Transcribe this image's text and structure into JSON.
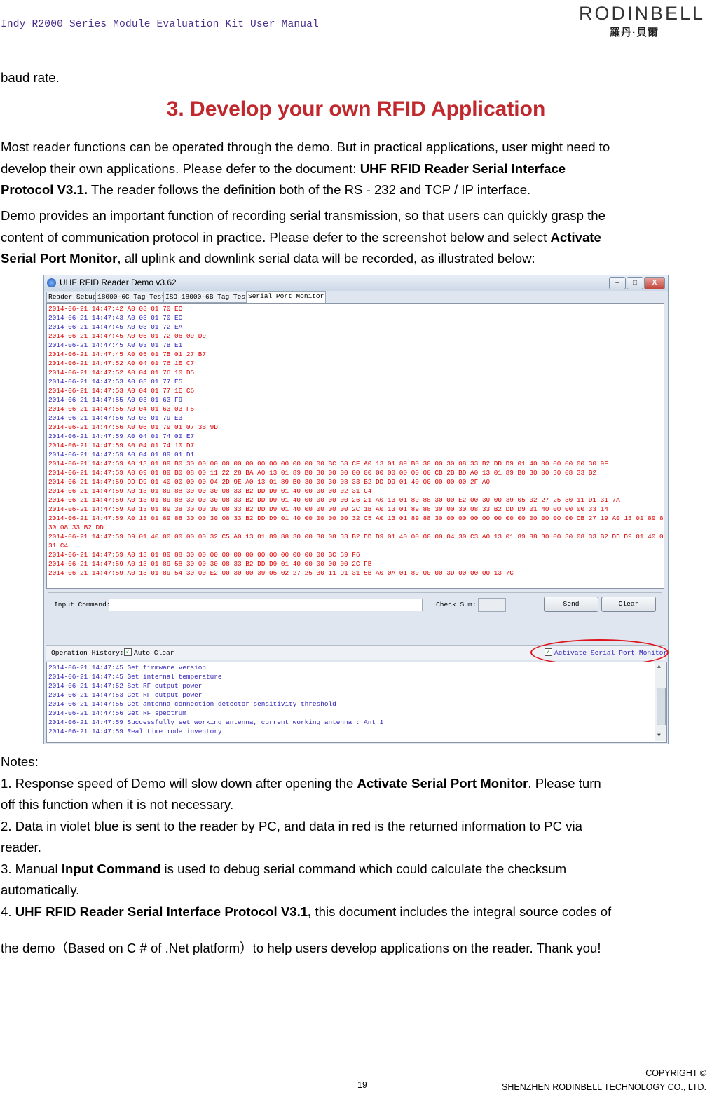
{
  "header": {
    "title": "Indy R2000 Series Module Evaluation Kit User Manual",
    "logo_text": "RODINBELL",
    "logo_sub": "羅丹·貝爾"
  },
  "intro_line": "baud rate.",
  "heading": "3. Develop your own RFID Application",
  "para1": {
    "l1": "Most reader functions can be operated through the demo. But in practical applications, user might need to",
    "l2a": "develop their own applications. Please defer to the document: ",
    "l2b": "UHF RFID Reader Serial Interface",
    "l3a": "Protocol V3.1.",
    "l3b": " The reader follows the definition both of the RS - 232 and TCP / IP interface."
  },
  "para2": {
    "l1": "Demo provides an important function of recording serial transmission, so that users can quickly grasp the",
    "l2a": "content of communication protocol in practice. Please defer to the screenshot below and select ",
    "l2b": "Activate",
    "l3a": "Serial Port Monitor",
    "l3b": ", all uplink and downlink serial data will be recorded, as illustrated below:"
  },
  "screenshot": {
    "title": "UHF RFID Reader Demo v3.62",
    "win_buttons": [
      "–",
      "□",
      "X"
    ],
    "tabs": [
      "Reader Setup",
      "18000-6C Tag Test",
      "ISO 18000-6B Tag Test",
      "Serial Port Monitor"
    ],
    "active_tab": 3,
    "log": [
      {
        "c": "red",
        "t": "2014-06-21 14:47:42  A0 03 01 70 EC"
      },
      {
        "c": "blue",
        "t": "2014-06-21 14:47:43  A0 03 01 70 EC"
      },
      {
        "c": "blue",
        "t": "2014-06-21 14:47:45  A0 03 01 72 EA"
      },
      {
        "c": "red",
        "t": "2014-06-21 14:47:45  A0 05 01 72 06 09 D9"
      },
      {
        "c": "blue",
        "t": "2014-06-21 14:47:45  A0 03 01 7B E1"
      },
      {
        "c": "red",
        "t": "2014-06-21 14:47:45  A0 05 01 7B 01 27 B7"
      },
      {
        "c": "red",
        "t": "2014-06-21 14:47:52  A0 04 01 76 1E C7"
      },
      {
        "c": "red",
        "t": "2014-06-21 14:47:52  A0 04 01 76 10 D5"
      },
      {
        "c": "blue",
        "t": "2014-06-21 14:47:53  A0 03 01 77 E5"
      },
      {
        "c": "red",
        "t": "2014-06-21 14:47:53  A0 04 01 77 1E C6"
      },
      {
        "c": "blue",
        "t": "2014-06-21 14:47:55  A0 03 01 63 F9"
      },
      {
        "c": "red",
        "t": "2014-06-21 14:47:55  A0 04 01 63 03 F5"
      },
      {
        "c": "blue",
        "t": "2014-06-21 14:47:56  A0 03 01 79 E3"
      },
      {
        "c": "red",
        "t": "2014-06-21 14:47:56  A0 06 01 79 01 07 3B 9D"
      },
      {
        "c": "blue",
        "t": "2014-06-21 14:47:59  A0 04 01 74 00 E7"
      },
      {
        "c": "red",
        "t": "2014-06-21 14:47:59  A0 04 01 74 10 D7"
      },
      {
        "c": "blue",
        "t": "2014-06-21 14:47:59  A0 04 01 89 01 D1"
      },
      {
        "c": "red",
        "t": "2014-06-21 14:47:59  A0 13 01 89 B0 30 00 00 00 00 00 00 00 00 00 00 00 BC 58 CF A0 13 01 89 B0 30 00 30 08 33 B2 DD D9 01 40 00 00 00 00 30 9F"
      },
      {
        "c": "red",
        "t": "2014-06-21 14:47:59  A0 09 01 89 B0 08 00 11 22 28 BA A0 13 01 89 B0 30 00 00 00 00 00 00 00 00 00 CB 2B BD A0 13 01 89 B0 30 00 30 08 33 B2"
      },
      {
        "c": "red",
        "t": "2014-06-21 14:47:59  DD D9 01 40 00 00 00 04 2D 9E A0 13 01 89 B0 30 00 30 08 33 B2 DD D9 01 40 00 00 00 00 2F A0"
      },
      {
        "c": "red",
        "t": "2014-06-21 14:47:59  A0 13 01 89 88 30 00 30 08 33 B2 DD D9 01 40 00 00 00 02 31 C4"
      },
      {
        "c": "red",
        "t": "2014-06-21 14:47:59  A0 13 01 89 88 30 00 30 08 33 B2 DD D9 01 40 00 00 00 00 26 21 A0 13 01 89 88 30 00 E2 00 30 00 39 05 02 27 25 30 11 D1 31 7A"
      },
      {
        "c": "red",
        "t": "2014-06-21 14:47:59  A0 13 01 89 38 30 00 30 08 33 B2 DD D9 01 40 00 00 00 00 2C 1B A0 13 01 89 88 30 00 30 08 33 B2 DD D9 01 40 00 00 00 33 14"
      },
      {
        "c": "red",
        "t": "2014-06-21 14:47:59  A0 13 01 89 88 30 00 30 08 33 B2 DD D9 01 40 00 00 00 00 32 C5 A0 13 01 89 88 30 00 00 00 00 00 00 00 00 00 00 00 CB 27 19 A0 13 01 89 88 30 00"
      },
      {
        "c": "red",
        "t": "30 08 33 B2 DD"
      },
      {
        "c": "red",
        "t": "2014-06-21 14:47:59  D9 01 40 00 00 00 00 32 C5 A0 13 01 89 88 30 00 30 08 33 B2 DD D9 01 40 00 00 00 04 30 C3 A0 13 01 89 88 30 00 30 08 33 B2 DD D9 01 40 00 00 00 02"
      },
      {
        "c": "red",
        "t": "31 C4"
      },
      {
        "c": "red",
        "t": "2014-06-21 14:47:59  A0 13 01 89 88 30 00 00 00 00 00 00 00 00 00 00 00 BC 59 F6"
      },
      {
        "c": "red",
        "t": "2014-06-21 14:47:59  A0 13 01 89 58 30 00 30 08 33 B2 DD D9 01 40 00 00 00 00 2C FB"
      },
      {
        "c": "red",
        "t": "2014-06-21 14:47:59  A0 13 01 89 54 30 00 E2 00 30 00 39 05 02 27 25 30 11 D1 31 5B A0 0A 01 89 00 00 3D 00 00 00 13 7C"
      }
    ],
    "input_command_label": "Input Command:",
    "input_command_value": "",
    "checksum_label": "Check Sum:",
    "checksum_value": "",
    "send_label": "Send",
    "clear_label": "Clear",
    "op_history_label": "Operation History:",
    "auto_clear_label": "Auto Clear",
    "auto_clear_checked": true,
    "activate_label": "Activate Serial Port Monitor",
    "activate_checked": true,
    "history": [
      "2014-06-21 14:47:45 Get firmware version",
      "2014-06-21 14:47:45 Get internal temperature",
      "2014-06-21 14:47:52 Set RF output power",
      "2014-06-21 14:47:53 Get RF output power",
      "2014-06-21 14:47:55 Get antenna connection detector sensitivity threshold",
      "2014-06-21 14:47:56 Get RF spectrum",
      "2014-06-21 14:47:59 Successfully set working antenna, current working antenna : Ant 1",
      "2014-06-21 14:47:59 Real time mode inventory"
    ]
  },
  "notes": {
    "title": "Notes:",
    "n1a": "1. Response speed of Demo will slow down after opening the ",
    "n1b": "Activate Serial Port Monitor",
    "n1c": ". Please turn",
    "n1d": "off this function when it is not necessary.",
    "n2a": "2. Data in violet blue is sent to the reader by PC, and data in red is the returned information to PC via",
    "n2b": "reader.",
    "n3a": "3. Manual ",
    "n3b": "Input Command",
    "n3c": " is used to debug serial command which could calculate the checksum",
    "n3d": "automatically.",
    "n4a": "4. ",
    "n4b": "UHF RFID Reader Serial Interface Protocol V3.1,",
    "n4c": " this document includes the integral source codes of",
    "n4d": "the demo（Based on C # of .Net platform）to help users develop applications on the reader. Thank you!"
  },
  "footer": {
    "page": "19",
    "copyright": "COPYRIGHT ©",
    "company": "SHENZHEN RODINBELL TECHNOLOGY CO., LTD."
  },
  "colors": {
    "heading": "#c0282d",
    "sent_data": "#3226b8",
    "received_data": "#e00000",
    "highlight_oval": "#e0141c"
  }
}
